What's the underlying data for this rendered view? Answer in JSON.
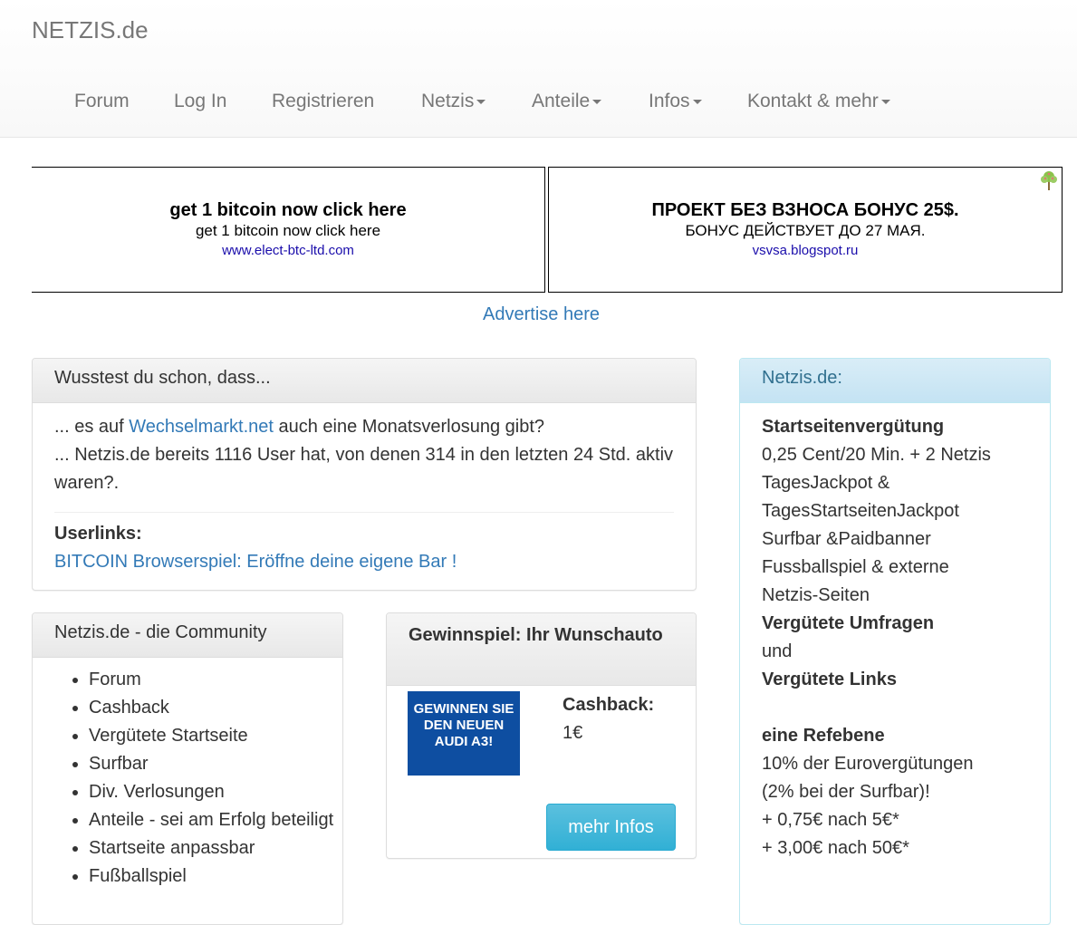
{
  "brand": "NETZIS.de",
  "nav": {
    "forum": "Forum",
    "login": "Log In",
    "register": "Registrieren",
    "netzis": "Netzis",
    "anteile": "Anteile",
    "infos": "Infos",
    "kontakt": "Kontakt & mehr"
  },
  "ads": [
    {
      "title": "get 1 bitcoin now click here",
      "text": "get 1 bitcoin now click here",
      "url": "www.elect-btc-ltd.com"
    },
    {
      "title": "ПРОЕКТ БЕЗ ВЗНОСА БОНУС 25$.",
      "text": "БОНУС ДЕЙСТВУЕТ ДО 27 МАЯ.",
      "url": "vsvsa.blogspot.ru"
    }
  ],
  "advertise": "Advertise here",
  "didyouknow": {
    "heading": "Wusstest du schon, dass...",
    "line1_pre": "... es auf ",
    "line1_link": "Wechselmarkt.net",
    "line1_post": " auch eine Monatsverlosung gibt?",
    "line2": "... Netzis.de bereits 1116 User hat, von denen 314 in den letzten 24 Std. aktiv waren?.",
    "userlinks_label": "Userlinks:",
    "userlink": "BITCOIN Browserspiel: Eröffne deine eigene Bar !"
  },
  "community": {
    "heading": "Netzis.de - die Community",
    "items": [
      "Forum",
      "Cashback",
      "Vergütete Startseite",
      "Surfbar",
      "Div. Verlosungen",
      "Anteile - sei am Erfolg beteiligt",
      "Startseite anpassbar",
      "Fußballspiel"
    ]
  },
  "gewinnspiel": {
    "heading": "Gewinnspiel: Ihr Wunschauto",
    "image_text": "GEWINNEN SIE DEN NEUEN AUDI A3!",
    "cashback_label": "Cashback:",
    "cashback_value": "1€",
    "button": "mehr Infos"
  },
  "sidebar": {
    "heading": "Netzis.de:",
    "startseite_title": "Startseitenvergütung",
    "startseite_lines": [
      "0,25 Cent/20 Min. + 2 Netzis",
      "TagesJackpot &",
      "TagesStartseitenJackpot",
      "Surfbar &Paidbanner",
      "Fussballspiel & externe",
      "Netzis-Seiten"
    ],
    "umfragen": "Vergütete Umfragen",
    "und": "und",
    "links": "Vergütete Links",
    "refebene_title": "eine Refebene",
    "ref_lines": [
      "10% der Eurovergütungen",
      "(2% bei der Surfbar)!",
      "+ 0,75€ nach 5€*",
      "+ 3,00€ nach 50€*"
    ]
  },
  "colors": {
    "link": "#337ab7",
    "info_button": "#5bc0de",
    "sidebar_heading_bg": "#d9edf7",
    "image_bg": "#0e4ea1"
  }
}
